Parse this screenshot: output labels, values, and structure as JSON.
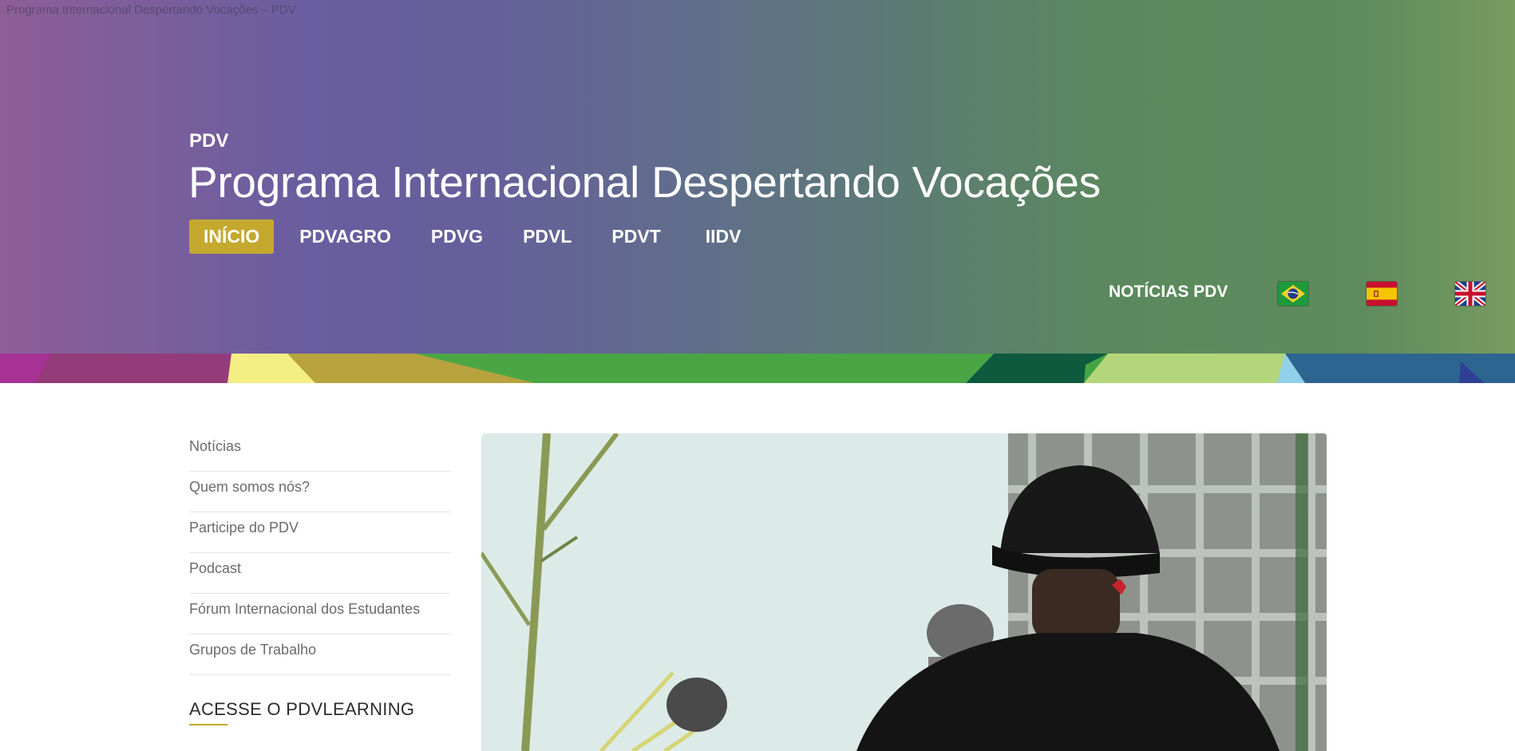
{
  "browser": {
    "tab_title": "Programa Internacional Despertando Vocações – PDV"
  },
  "header": {
    "kicker": "PDV",
    "title": "Programa Internacional Despertando Vocações"
  },
  "nav": {
    "items": [
      {
        "label": "INÍCIO",
        "active": true
      },
      {
        "label": "PDVAGRO"
      },
      {
        "label": "PDVG"
      },
      {
        "label": "PDVL"
      },
      {
        "label": "PDVT"
      },
      {
        "label": "IIDV"
      }
    ]
  },
  "secondary_nav": {
    "news_label": "NOTÍCIAS PDV",
    "languages": [
      {
        "icon": "brazil-flag-icon"
      },
      {
        "icon": "spain-flag-icon"
      },
      {
        "icon": "uk-flag-icon"
      }
    ]
  },
  "sidebar": {
    "items": [
      {
        "label": "Notícias"
      },
      {
        "label": "Quem somos nós?"
      },
      {
        "label": "Participe do PDV"
      },
      {
        "label": "Podcast"
      },
      {
        "label": "Fórum Internacional dos Estudantes"
      },
      {
        "label": "Grupos de Trabalho"
      }
    ],
    "heading": "ACESSE O PDVLEARNING"
  },
  "colors": {
    "accent": "#c4a92e",
    "header_start": "#8e5e97",
    "header_end": "#789b5f"
  }
}
